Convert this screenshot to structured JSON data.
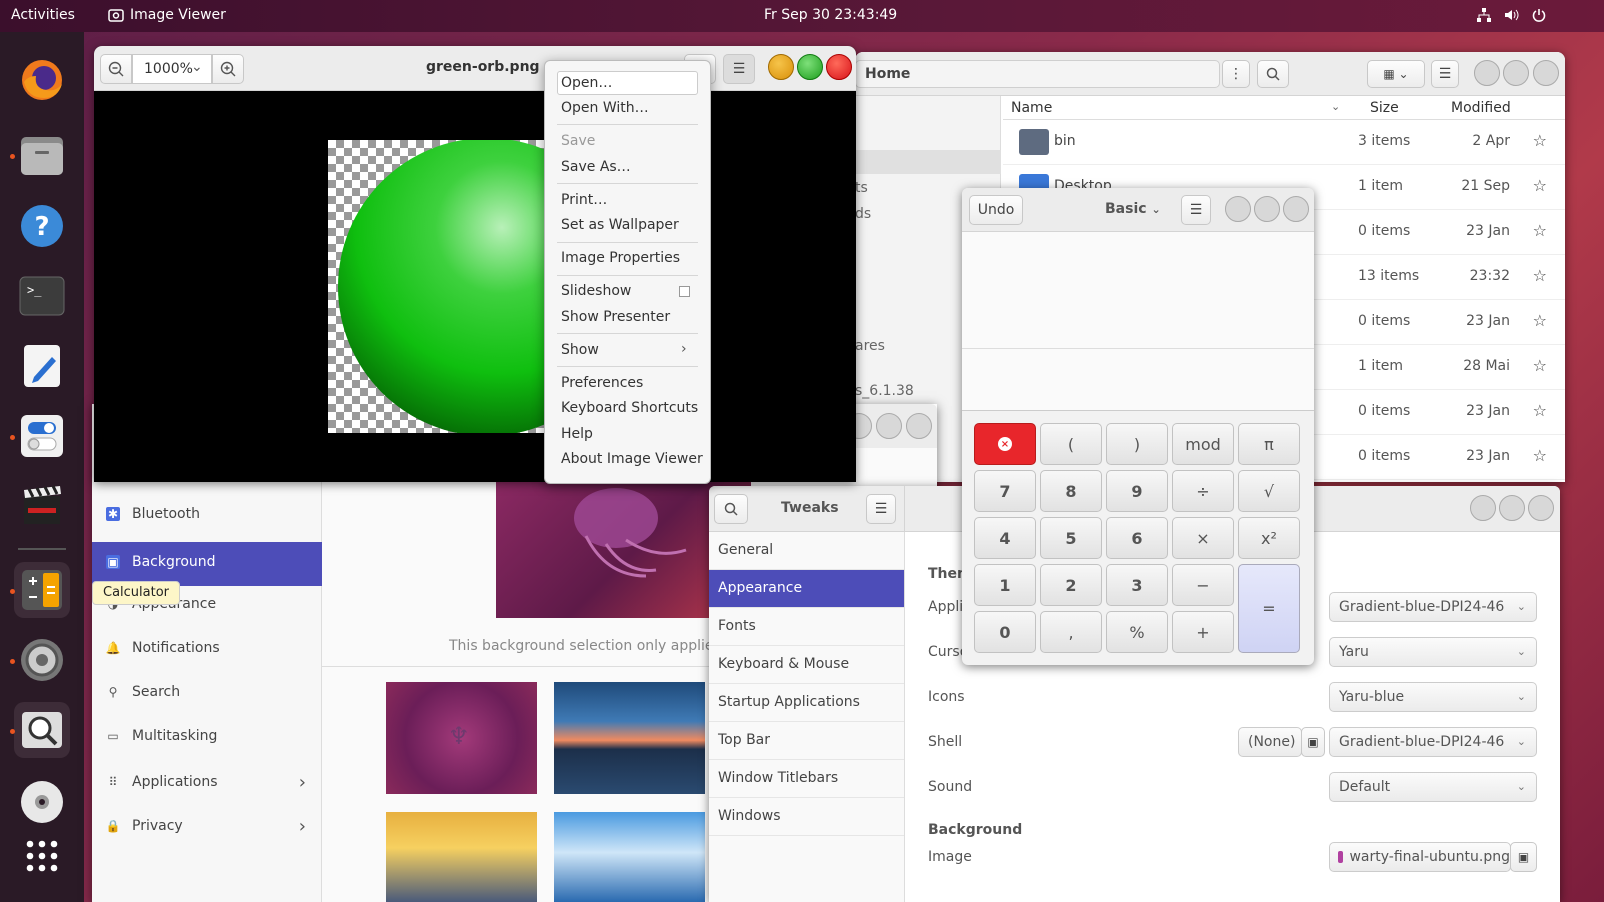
{
  "topbar": {
    "activities": "Activities",
    "app_name": "Image Viewer",
    "clock": "Fr Sep 30  23:43:49"
  },
  "dock": {
    "tooltip": "Calculator",
    "icons": [
      "firefox-icon",
      "files-icon",
      "help-icon",
      "terminal-icon",
      "text-editor-icon",
      "settings-toggle-icon",
      "video-editor-icon",
      "calculator-icon",
      "disk-settings-icon",
      "image-viewer-icon",
      "optical-disc-icon",
      "app-grid-icon"
    ]
  },
  "settings": {
    "items": [
      "Bluetooth",
      "Background",
      "Appearance",
      "Notifications",
      "Search",
      "Multitasking",
      "Applications",
      "Privacy"
    ],
    "selected": "Background",
    "bg_note": "This background selection only applies t"
  },
  "files": {
    "path": "Home",
    "columns": {
      "name": "Name",
      "size": "Size",
      "modified": "Modified"
    },
    "rows": [
      {
        "name": "bin",
        "size": "3 items",
        "modified": "2 Apr"
      },
      {
        "name": "Desktop",
        "size": "1 item",
        "modified": "21 Sep"
      },
      {
        "name": "",
        "size": "0 items",
        "modified": "23 Jan"
      },
      {
        "name": "",
        "size": "13 items",
        "modified": "23:32"
      },
      {
        "name": "",
        "size": "0 items",
        "modified": "23 Jan"
      },
      {
        "name": "",
        "size": "1 item",
        "modified": "28 Mai"
      },
      {
        "name": "",
        "size": "0 items",
        "modified": "23 Jan"
      },
      {
        "name": "",
        "size": "0 items",
        "modified": "23 Jan"
      }
    ],
    "partial_texts": [
      "ts",
      "ds",
      "ares",
      "s_6.1.38"
    ]
  },
  "image_viewer": {
    "zoom": "1000%",
    "filename": "green-orb.png"
  },
  "menu": {
    "open": "Open…",
    "open_with": "Open With…",
    "save": "Save",
    "save_as": "Save As…",
    "print": "Print…",
    "wallpaper": "Set as Wallpaper",
    "properties": "Image Properties",
    "slideshow": "Slideshow",
    "presenter": "Show Presenter",
    "show": "Show",
    "preferences": "Preferences",
    "shortcuts": "Keyboard Shortcuts",
    "help": "Help",
    "about": "About Image Viewer"
  },
  "calculator": {
    "undo": "Undo",
    "mode": "Basic",
    "keys": [
      [
        "×",
        "(",
        ")",
        "mod",
        "π"
      ],
      [
        "7",
        "8",
        "9",
        "÷",
        "√"
      ],
      [
        "4",
        "5",
        "6",
        "×",
        "x²"
      ],
      [
        "1",
        "2",
        "3",
        "−",
        "="
      ],
      [
        "0",
        ",",
        "%",
        "+"
      ]
    ]
  },
  "tweaks": {
    "title": "Tweaks",
    "items": [
      "General",
      "Appearance",
      "Fonts",
      "Keyboard & Mouse",
      "Startup Applications",
      "Top Bar",
      "Window Titlebars",
      "Windows"
    ],
    "selected": "Appearance",
    "themes_partial": "Them",
    "labels": {
      "applications": "Appli",
      "cursor": "Curso",
      "icons": "Icons",
      "shell": "Shell",
      "sound": "Sound",
      "background": "Background",
      "image": "Image"
    },
    "values": {
      "applications": "Gradient-blue-DPI24-46",
      "cursor": "Yaru",
      "icons": "Yaru-blue",
      "shell_none": "(None)",
      "shell": "Gradient-blue-DPI24-46",
      "sound": "Default",
      "image": "warty-final-ubuntu.png"
    }
  },
  "colors": {
    "accent": "#4d4db8",
    "red_close": "#e8262b"
  }
}
